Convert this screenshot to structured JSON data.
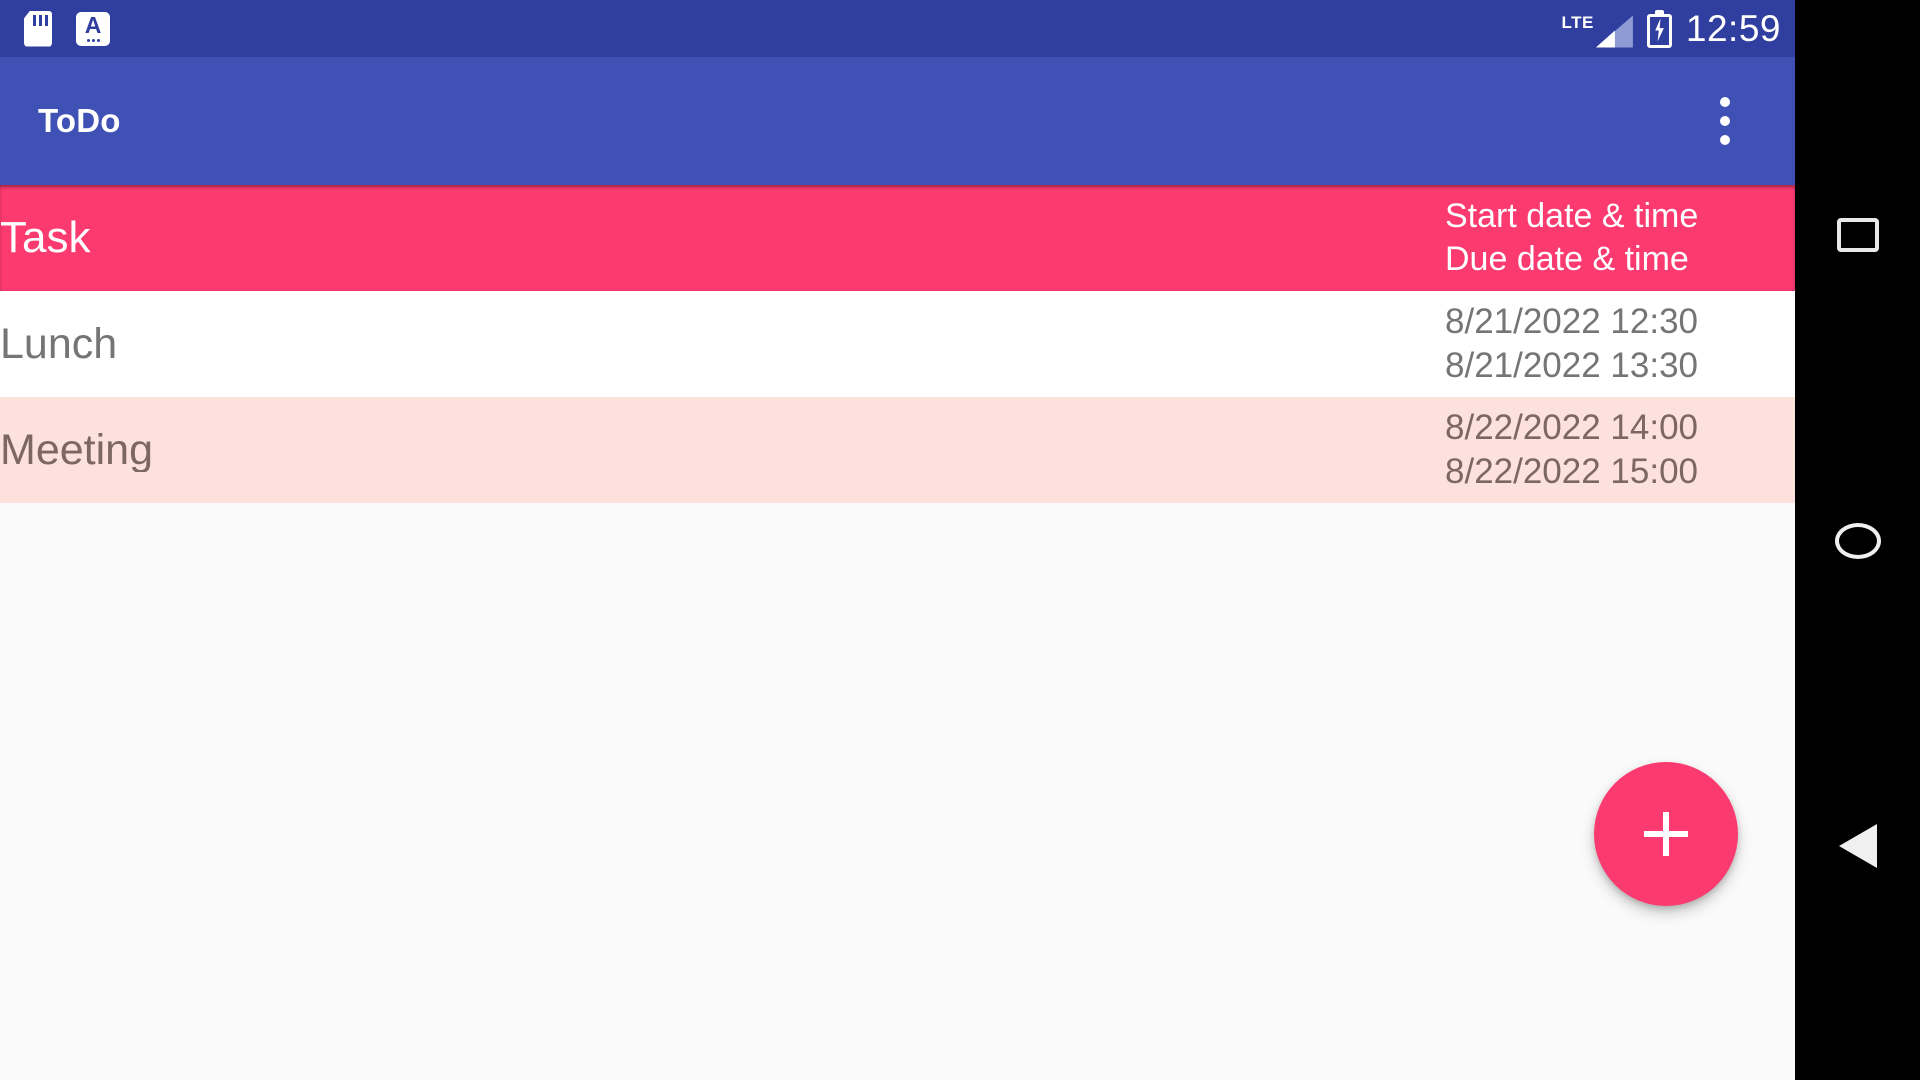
{
  "status_bar": {
    "background": "#303f9f",
    "icons": [
      {
        "name": "sd-card-icon",
        "label": "SD card"
      },
      {
        "name": "alphabet-input-icon",
        "label": "A"
      }
    ],
    "network_label": "LTE",
    "battery_state": "charging",
    "time": "12:59"
  },
  "app_bar": {
    "background": "#3f51b5",
    "title": "ToDo",
    "overflow_menu_label": "More options"
  },
  "table": {
    "header": {
      "background": "#fb3b70",
      "task_column": "Task",
      "start_column": "Start date & time",
      "due_column": "Due date & time"
    },
    "rows": [
      {
        "task": "Lunch",
        "start": "8/21/2022 12:30",
        "due": "8/21/2022 13:30",
        "background": "#ffffff"
      },
      {
        "task": "Meeting",
        "start": "8/22/2022 14:00",
        "due": "8/22/2022 15:00",
        "background": "#fce1dc"
      }
    ]
  },
  "fab": {
    "label": "+",
    "accent": "#fb3b70",
    "action": "Add task"
  },
  "nav_bar": {
    "background": "#000000",
    "buttons": [
      {
        "name": "recents-button",
        "glyph": "square"
      },
      {
        "name": "home-button",
        "glyph": "circle"
      },
      {
        "name": "back-button",
        "glyph": "triangle"
      }
    ]
  }
}
